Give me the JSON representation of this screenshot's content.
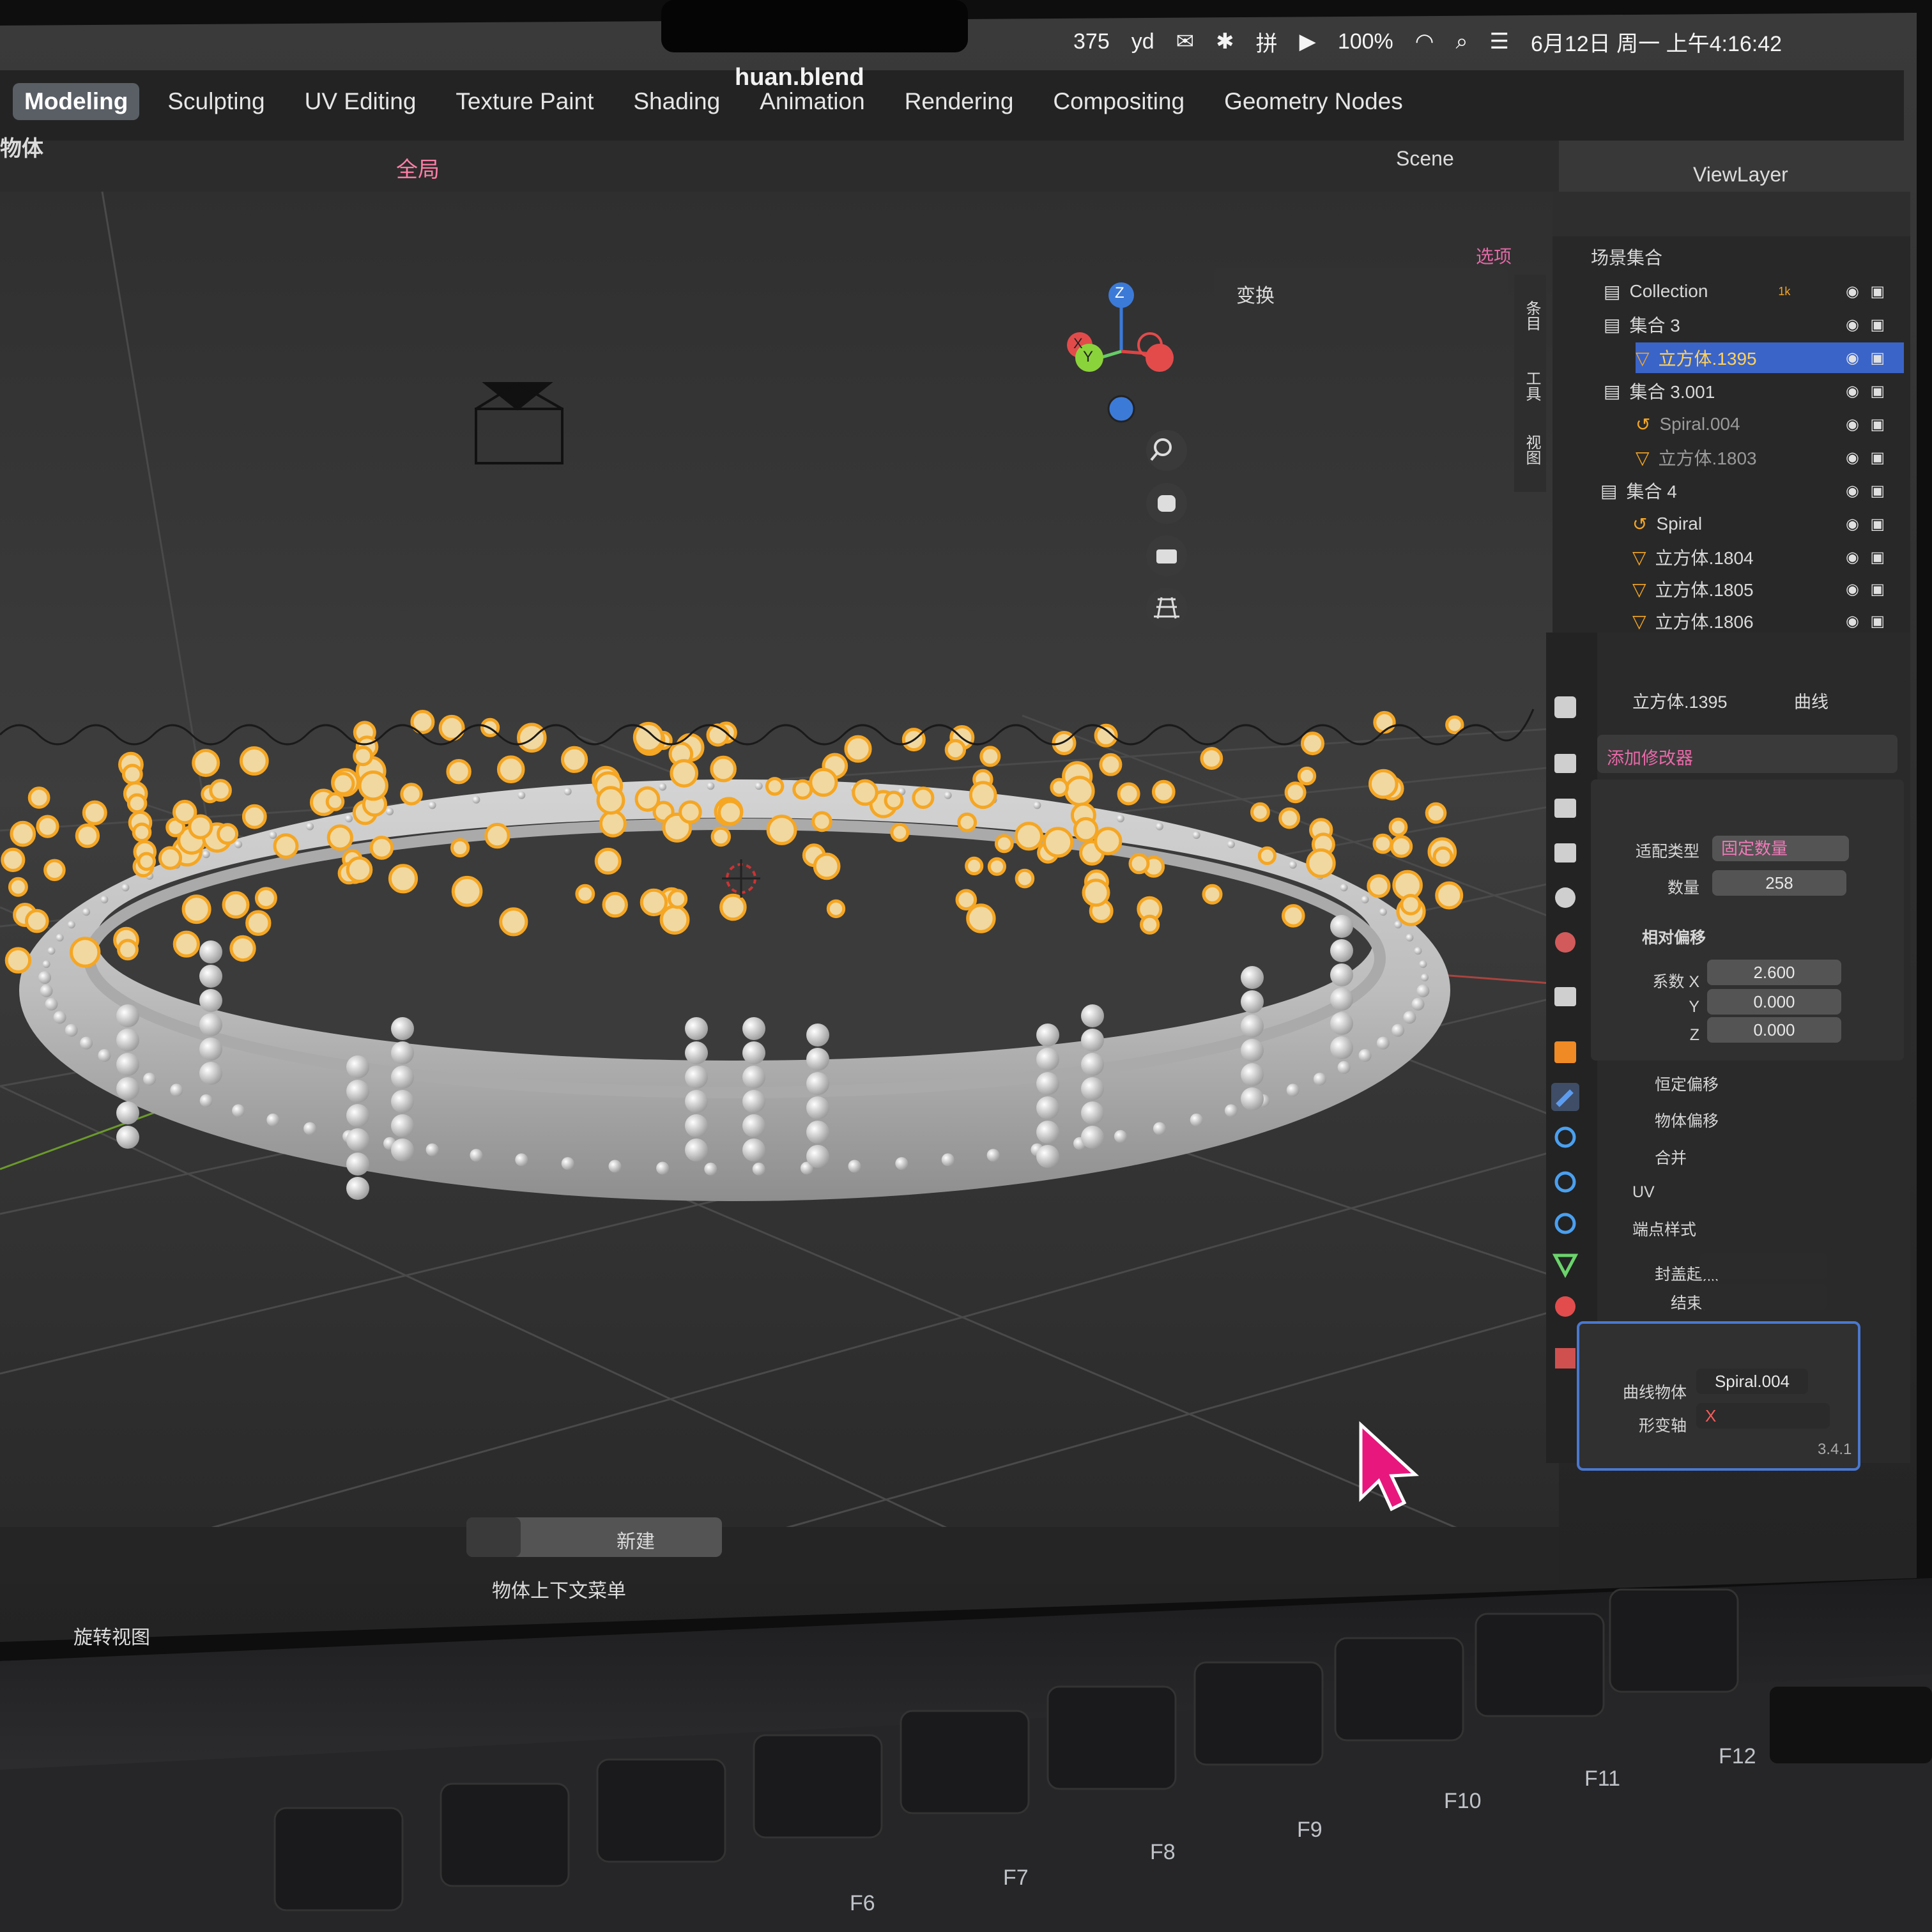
{
  "menubar": {
    "notif_count": "375",
    "icons": [
      "audio-icon",
      "youdao-icon",
      "wechat-icon",
      "bluetooth-icon",
      "input-method-icon",
      "play-icon"
    ],
    "battery": "100%",
    "datetime": "6月12日 周一  上午4:16:42"
  },
  "window": {
    "title": "huan.blend"
  },
  "workspace_tabs": [
    {
      "label": "Modeling",
      "active": true
    },
    {
      "label": "Sculpting"
    },
    {
      "label": "UV Editing"
    },
    {
      "label": "Texture Paint"
    },
    {
      "label": "Shading"
    },
    {
      "label": "Animation"
    },
    {
      "label": "Rendering"
    },
    {
      "label": "Compositing"
    },
    {
      "label": "Geometry Nodes"
    }
  ],
  "header": {
    "mode_partial": "物体",
    "transform_orientation": "全局",
    "scene": "Scene",
    "view_layer": "ViewLayer",
    "options": "选项"
  },
  "viewport": {
    "n_panel_transform": "变换",
    "gizmo_axes": [
      "Z",
      "Y",
      "X"
    ],
    "nav_icons": [
      "zoom-icon",
      "pan-hand-icon",
      "camera-view-icon",
      "ortho-grid-icon"
    ],
    "side_tabs": [
      "条目",
      "工具",
      "视图"
    ]
  },
  "outliner": {
    "root": "场景集合",
    "rows": [
      {
        "name": "Collection",
        "type": "collection",
        "badge": "1k"
      },
      {
        "name": "集合 3",
        "type": "collection"
      },
      {
        "name": "立方体.1395",
        "type": "mesh",
        "selected": true
      },
      {
        "name": "集合 3.001",
        "type": "collection"
      },
      {
        "name": "Spiral.004",
        "type": "curve",
        "dim": true
      },
      {
        "name": "立方体.1803",
        "type": "mesh",
        "dim": true
      },
      {
        "name": "集合 4",
        "type": "collection"
      },
      {
        "name": "Spiral",
        "type": "curve"
      },
      {
        "name": "立方体.1804",
        "type": "mesh"
      },
      {
        "name": "立方体.1805",
        "type": "mesh"
      },
      {
        "name": "立方体.1806",
        "type": "mesh"
      }
    ]
  },
  "properties": {
    "breadcrumb_object": "立方体.1395",
    "breadcrumb_data": "曲线",
    "add_modifier": "添加修改器",
    "array": {
      "fit_type_label": "适配类型",
      "fit_type_value": "固定数量",
      "count_label": "数量",
      "count_value": "258",
      "relative_offset": "相对偏移",
      "factor_x_label": "系数 X",
      "factor_x": "2.600",
      "y_label": "Y",
      "y": "0.000",
      "z_label": "Z",
      "z": "0.000",
      "sections": [
        "恒定偏移",
        "物体偏移",
        "合并",
        "UV",
        "端点样式"
      ],
      "cap_start": "封盖起点",
      "cap_end": "结束点"
    },
    "curve_mod": {
      "curve_object_label": "曲线物体",
      "curve_object": "Spiral.004",
      "deform_axis_label": "形变轴",
      "deform_axis": "X"
    },
    "version": "3.4.1"
  },
  "bottom": {
    "new_button": "新建",
    "context_menu": "物体上下文菜单",
    "rotate_view": "旋转视图"
  },
  "keyboard": {
    "fkeys": [
      "F6",
      "F7",
      "F8",
      "F9",
      "F10",
      "F11",
      "F12"
    ]
  },
  "colors": {
    "accent_blue": "#3b64c8",
    "selected_orange": "#f5a623",
    "cursor_pink": "#e8177d"
  }
}
